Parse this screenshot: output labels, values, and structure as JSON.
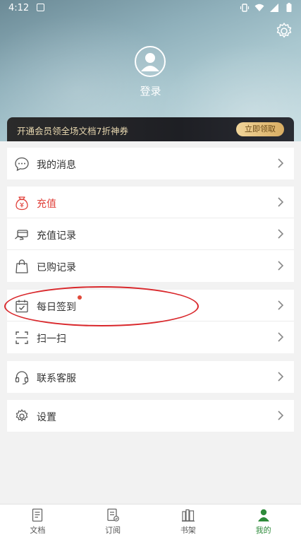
{
  "status_bar": {
    "time": "4:12"
  },
  "header": {
    "login_label": "登录",
    "vip_banner": {
      "text": "开通会员领全场文档7折神券",
      "button_label": "立即领取"
    }
  },
  "menu": {
    "messages": {
      "label": "我的消息",
      "icon": "message-icon"
    },
    "recharge": {
      "label": "充值",
      "icon": "money-bag-icon"
    },
    "recharge_history": {
      "label": "充值记录",
      "icon": "card-icon"
    },
    "purchase_history": {
      "label": "已购记录",
      "icon": "shopping-bag-icon"
    },
    "daily_checkin": {
      "label": "每日签到",
      "icon": "calendar-check-icon"
    },
    "scan": {
      "label": "扫一扫",
      "icon": "scan-icon"
    },
    "customer_service": {
      "label": "联系客服",
      "icon": "headset-icon"
    },
    "settings": {
      "label": "设置",
      "icon": "gear-icon"
    }
  },
  "tabs": [
    {
      "label": "文档",
      "icon": "document-icon",
      "active": false
    },
    {
      "label": "订阅",
      "icon": "subscribe-icon",
      "active": false
    },
    {
      "label": "书架",
      "icon": "bookshelf-icon",
      "active": false
    },
    {
      "label": "我的",
      "icon": "user-icon",
      "active": true
    }
  ],
  "colors": {
    "accent": "#2e8b3a",
    "highlight": "#e0403a",
    "annotation": "#d9282c"
  }
}
